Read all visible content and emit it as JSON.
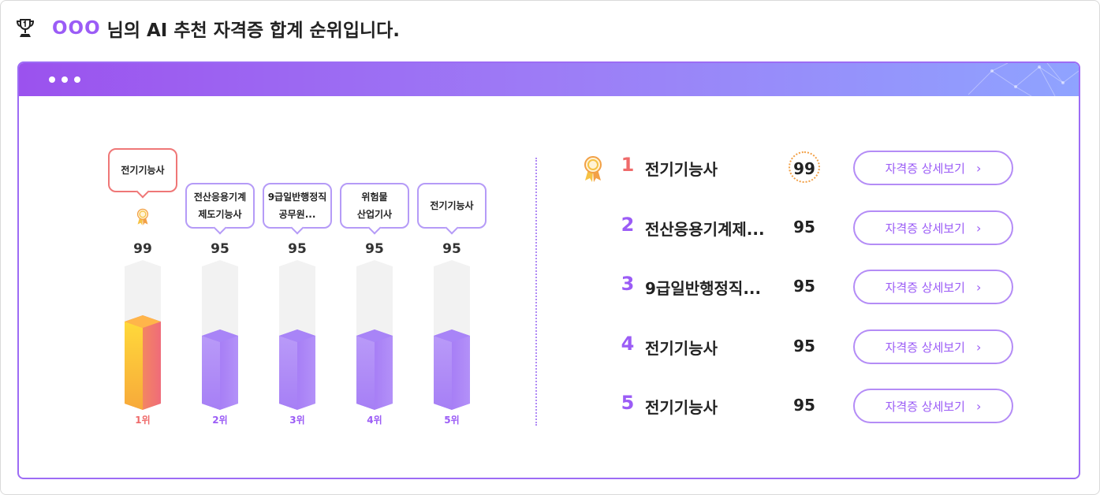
{
  "header": {
    "user": "OOO",
    "title": "님의 AI 추천 자격증 합계 순위입니다.",
    "icon": "trophy-icon"
  },
  "colors": {
    "accent": "#9b5cf6",
    "first": "#ef6b6b",
    "gold": "#f6c244"
  },
  "chart_data": {
    "type": "bar",
    "categories": [
      "전기기능사",
      "전산응용기계제도기능사",
      "9급일반행정직공무원",
      "위험물산업기사",
      "전기기능사"
    ],
    "category_labels": [
      [
        "전기기능사"
      ],
      [
        "전산응용기계",
        "제도기능사"
      ],
      [
        "9급일반행정직",
        "공무원..."
      ],
      [
        "위험물",
        "산업기사"
      ],
      [
        "전기기능사"
      ]
    ],
    "values": [
      99,
      95,
      95,
      95,
      95
    ],
    "ranks": [
      "1위",
      "2위",
      "3위",
      "4위",
      "5위"
    ]
  },
  "ranking": [
    {
      "rank": "1",
      "name": "전기기능사",
      "score": "99",
      "button": "자격증 상세보기"
    },
    {
      "rank": "2",
      "name": "전산응용기계제...",
      "score": "95",
      "button": "자격증 상세보기"
    },
    {
      "rank": "3",
      "name": "9급일반행정직...",
      "score": "95",
      "button": "자격증 상세보기"
    },
    {
      "rank": "4",
      "name": "전기기능사",
      "score": "95",
      "button": "자격증 상세보기"
    },
    {
      "rank": "5",
      "name": "전기기능사",
      "score": "95",
      "button": "자격증 상세보기"
    }
  ]
}
